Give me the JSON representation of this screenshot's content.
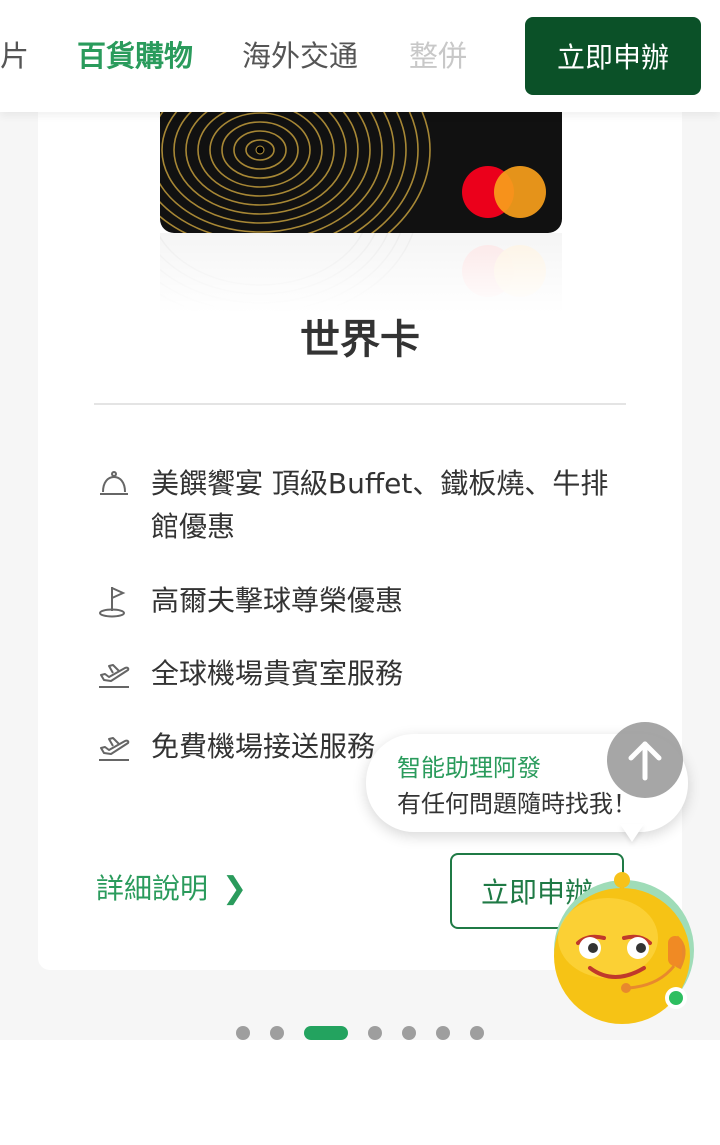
{
  "nav": {
    "tabs": [
      {
        "label": "片"
      },
      {
        "label": "百貨購物"
      },
      {
        "label": "海外交通"
      },
      {
        "label": "整併"
      }
    ],
    "active_index": 1,
    "apply_label": "立即申辦"
  },
  "card": {
    "name": "世界卡",
    "features": [
      {
        "icon": "cloche-icon",
        "text": "美饌饗宴 頂級Buffet、鐵板燒、牛排館優惠"
      },
      {
        "icon": "golf-flag-icon",
        "text": "高爾夫擊球尊榮優惠"
      },
      {
        "icon": "airplane-takeoff-icon",
        "text": "全球機場貴賓室服務"
      },
      {
        "icon": "airplane-takeoff-icon",
        "text": "免費機場接送服務"
      }
    ],
    "details_label": "詳細說明",
    "apply_label": "立即申辦"
  },
  "pagination": {
    "count": 7,
    "active_index": 2
  },
  "assistant": {
    "title": "智能助理阿發",
    "message": "有任何問題隨時找我！"
  },
  "colors": {
    "brand_green": "#2a9b5c",
    "dark_green": "#0b5128",
    "mastercard_red": "#eb001b",
    "mastercard_orange": "#f79e1b"
  }
}
